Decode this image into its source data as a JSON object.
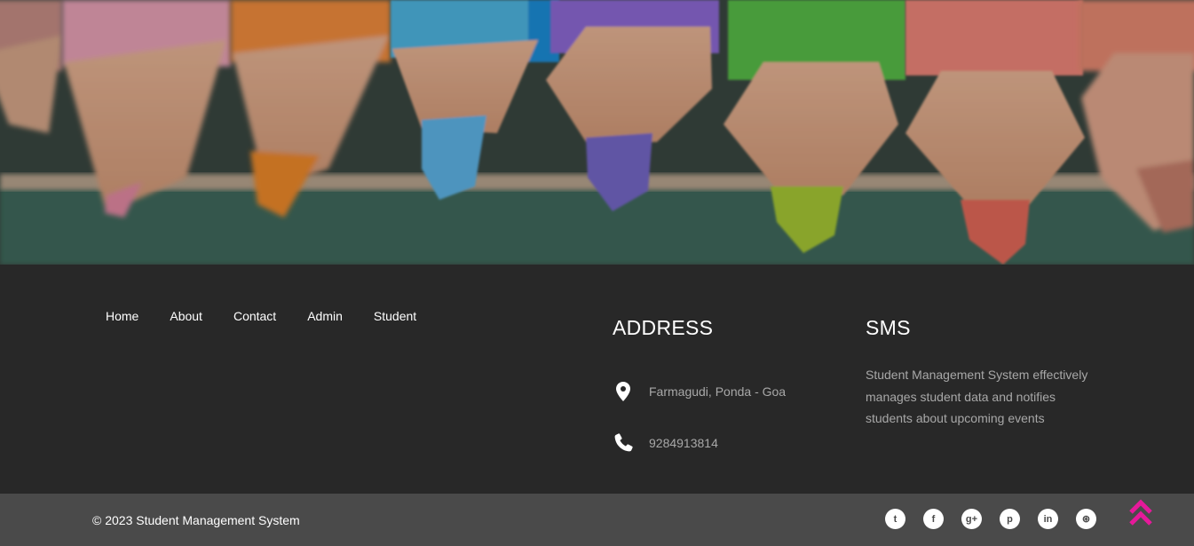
{
  "nav": {
    "items": [
      {
        "label": "Home"
      },
      {
        "label": "About"
      },
      {
        "label": "Contact"
      },
      {
        "label": "Admin"
      },
      {
        "label": "Student"
      }
    ]
  },
  "address": {
    "heading": "ADDRESS",
    "location": "Farmagudi, Ponda - Goa",
    "phone": "9284913814",
    "location_icon": "map-marker-icon",
    "phone_icon": "phone-icon"
  },
  "sms": {
    "heading": "SMS",
    "description": "Student Management System effectively manages student data and notifies students about upcoming events"
  },
  "bottom": {
    "copyright": "© 2023 Student Management System",
    "socials": [
      {
        "icon": "twitter-icon",
        "glyph": "t"
      },
      {
        "icon": "facebook-icon",
        "glyph": "f"
      },
      {
        "icon": "google-plus-icon",
        "glyph": "g+"
      },
      {
        "icon": "pinterest-icon",
        "glyph": "p"
      },
      {
        "icon": "linkedin-icon",
        "glyph": "in"
      },
      {
        "icon": "dribbble-icon",
        "glyph": "⊛"
      }
    ],
    "back_to_top_icon": "double-chevron-up-icon",
    "accent_color": "#e6199a"
  },
  "colors": {
    "footer_bg": "#282828",
    "bottom_bar_bg": "#4a4a4a",
    "muted_text": "#a8a8a8"
  }
}
